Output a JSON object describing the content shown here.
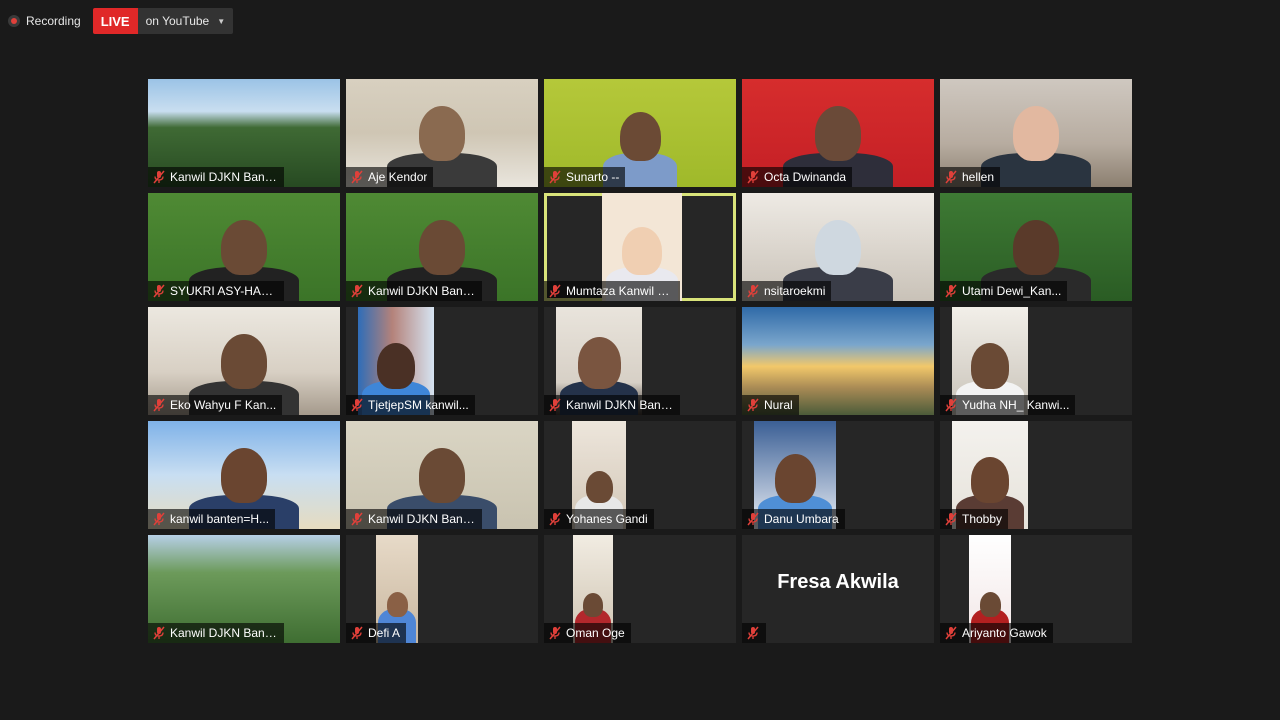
{
  "topbar": {
    "recording_label": "Recording",
    "live_label": "LIVE",
    "live_destination": "on YouTube"
  },
  "participants": [
    {
      "name": "Kanwil DJKN Bant...",
      "scene": "waterfall"
    },
    {
      "name": "Aje Kendor",
      "scene": "room"
    },
    {
      "name": "Sunarto --",
      "scene": "green-wall"
    },
    {
      "name": "Octa Dwinanda",
      "scene": "red-banner"
    },
    {
      "name": "hellen",
      "scene": "trees"
    },
    {
      "name": "SYUKRI ASY-HADHY",
      "scene": "green-banner"
    },
    {
      "name": "Kanwil DJKN Banten ...",
      "scene": "green-banner"
    },
    {
      "name": "Mumtaza Kanwil DJK...",
      "scene": "small-face",
      "active": true
    },
    {
      "name": "nsitaroekmi",
      "scene": "mask"
    },
    {
      "name": "Utami Dewi_Kan...",
      "scene": "plants"
    },
    {
      "name": "Eko Wahyu F Kan...",
      "scene": "ceiling"
    },
    {
      "name": "TjetjepSM kanwil...",
      "scene": "curtain"
    },
    {
      "name": "Kanwil DJKN Bant...",
      "scene": "office"
    },
    {
      "name": "Nural",
      "scene": "sunset"
    },
    {
      "name": "Yudha NH_ Kanwi...",
      "scene": "brick"
    },
    {
      "name": "kanwil banten=H...",
      "scene": "beach"
    },
    {
      "name": "Kanwil DJKN Bant...",
      "scene": "wallpaper"
    },
    {
      "name": "Yohanes Gandi",
      "scene": "hallway"
    },
    {
      "name": "Danu Umbara",
      "scene": "blue-shirt"
    },
    {
      "name": "Thobby",
      "scene": "white-wall"
    },
    {
      "name": "Kanwil DJKN Bant...",
      "scene": "hills"
    },
    {
      "name": "Defi A",
      "scene": "man-blue"
    },
    {
      "name": "Oman Oge",
      "scene": "batik"
    },
    {
      "name": "",
      "scene": "name-only",
      "display_name": "Fresa Akwila"
    },
    {
      "name": "Ariyanto Gawok",
      "scene": "pancasila"
    }
  ],
  "icons": {
    "mic": "mic-muted-icon",
    "record": "record-dot-icon",
    "dropdown": "chevron-down-icon"
  },
  "colors": {
    "background": "#1a1a1a",
    "live": "#e02828",
    "active_speaker": "#d9e37a",
    "muted": "#e0403a"
  }
}
